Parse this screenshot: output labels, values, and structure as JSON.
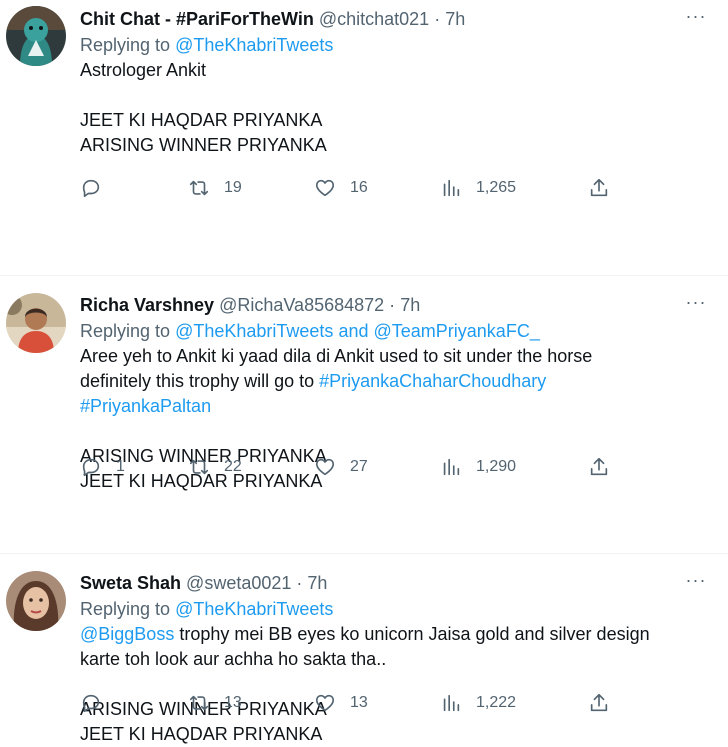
{
  "tweets": [
    {
      "name": "Chit Chat - #PariForTheWin",
      "handle": "@chitchat021",
      "dot": "·",
      "time": "7h",
      "more": "···",
      "replying_to_label": "Replying to",
      "replying_mentions": [
        "@TheKhabriTweets"
      ],
      "replying_joiner": "",
      "text_lines": [
        "Astrologer Ankit",
        "",
        "JEET KI HAQDAR PRIYANKA",
        "ARISING WINNER PRIYANKA"
      ],
      "counts": {
        "replies": "",
        "retweets": "19",
        "likes": "16",
        "views": "1,265"
      }
    },
    {
      "name": "Richa Varshney",
      "handle": "@RichaVa85684872",
      "dot": "·",
      "time": "7h",
      "more": "···",
      "replying_to_label": "Replying to",
      "replying_mentions": [
        "@TheKhabriTweets",
        "@TeamPriyankaFC_"
      ],
      "replying_joiner": "and",
      "text_line1": "Aree yeh to Ankit ki yaad dila di Ankit used to sit under the horse",
      "text_line2_plain": "definitely this trophy will go to",
      "hashtag1": "#PriyankaChaharChoudhary",
      "hashtag2": "#PriyankaPaltan",
      "text_tail": [
        "ARISING WINNER PRIYANKA",
        "JEET KI HAQDAR PRIYANKA"
      ],
      "counts": {
        "replies": "1",
        "retweets": "22",
        "likes": "27",
        "views": "1,290"
      }
    },
    {
      "name": "Sweta Shah",
      "handle": "@sweta0021",
      "dot": "·",
      "time": "7h",
      "more": "···",
      "replying_to_label": "Replying to",
      "replying_mentions": [
        "@TheKhabriTweets"
      ],
      "mention_inline": "@BiggBoss",
      "text_line1_rest": "trophy mei BB eyes ko unicorn Jaisa gold and silver design",
      "text_line2": "karte toh look aur achha ho sakta tha..",
      "text_tail": [
        "ARISING WINNER PRIYANKA",
        "JEET KI HAQDAR PRIYANKA"
      ],
      "counts": {
        "replies": "",
        "retweets": "13",
        "likes": "13",
        "views": "1,222"
      }
    }
  ],
  "icons": {
    "reply": "reply-icon",
    "retweet": "retweet-icon",
    "like": "heart-icon",
    "views": "views-icon",
    "share": "share-icon",
    "more": "more-icon"
  },
  "colors": {
    "text": "#0f1419",
    "muted": "#536471",
    "link": "#1d9bf0",
    "divider": "#eff3f4"
  }
}
